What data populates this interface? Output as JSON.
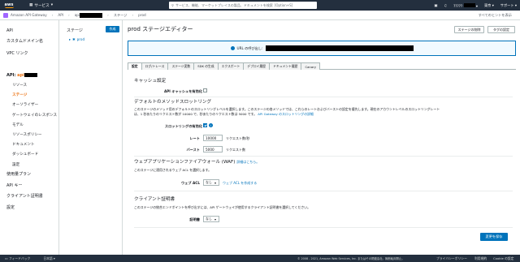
{
  "topbar": {
    "logo": "aws",
    "services": "サービス",
    "search_placeholder": "サービス、機能、マーケットプレイスの製品、ドキュメントを検索",
    "search_shortcut": "[Option+S]",
    "region": "東京",
    "account": "?????",
    "support": "サポート"
  },
  "breadcrumb": {
    "app": "Amazon API Gateway",
    "items": [
      "API",
      "api",
      "ステージ",
      "prod"
    ],
    "right_link": "すべてのヒントを表示"
  },
  "leftnav": {
    "items": [
      "API",
      "カスタムドメイン名",
      "VPC リンク"
    ],
    "api_header_label": "API:",
    "api_header_name": "api",
    "sub_items": [
      "リソース",
      "ステージ",
      "オーソライザー",
      "ゲートウェイのレスポンス",
      "モデル",
      "リソースポリシー",
      "ドキュメント",
      "ダッシュボード",
      "設定"
    ],
    "bottom_items": [
      "使用量プラン",
      "API キー",
      "クライアント証明書",
      "設定"
    ]
  },
  "stagepanel": {
    "title": "ステージ",
    "create": "作成",
    "tree_item": "prod"
  },
  "main": {
    "title": "prod ステージエディター",
    "delete_stage": "ステージの削除",
    "tag_settings": "タグの設定",
    "invoke_url_label": "URL の呼び出し:",
    "tabs": [
      "設定",
      "ログ/トレース",
      "ステージ変数",
      "SDK の生成",
      "エクスポート",
      "デプロイ履歴",
      "ドキュメント履歴",
      "Canary"
    ],
    "cache": {
      "title": "キャッシュ設定",
      "enable_label": "API キャッシュを有効化"
    },
    "throttle": {
      "title": "デフォルトのメソッドスロットリング",
      "desc_1": "このステージのメソッド用のデフォルトのスロットリングレベルを選択します。このステージの各メソッドでは、これらのレートおよびバーストの設定を優先します。現在のアカウントレベルのスロットリングレート",
      "desc_2": "は、1 秒あたりのリクエスト数が 10000 で、秒あたりのリクエスト数は 5000 です。",
      "desc_link": "API Gateway のスロットリングの詳細",
      "enable_label": "スロットリングの有効化",
      "rate_label": "レート",
      "rate_value": "10000",
      "rate_unit": "リクエスト数/秒",
      "burst_label": "バースト",
      "burst_value": "5000",
      "burst_unit": "リクエスト数"
    },
    "waf": {
      "title": "ウェブアプリケーションファイアウォール (WAF)",
      "detail_link": "詳細はこちら。",
      "desc": "このステージに適用されるウェブ ACL を選択します。",
      "label": "ウェブ ACL",
      "value": "なし",
      "create_link": "ウェブ ACL を作成する"
    },
    "cert": {
      "title": "クライアント証明書",
      "desc": "このステージの統合エンドポイントを呼び出すには、API ゲートウェイが使用するクライアント証明書を選択してください。",
      "label": "証明書",
      "value": "なし"
    },
    "save": "変更を保存"
  },
  "footer": {
    "feedback": "フィードバック",
    "language": "日本語",
    "copyright": "© 2008 - 2021, Amazon Web Services, Inc. またはその関連会社。無断転用禁止。",
    "privacy": "プライバシーポリシー",
    "terms": "利用規約",
    "cookie": "Cookie の設定"
  }
}
